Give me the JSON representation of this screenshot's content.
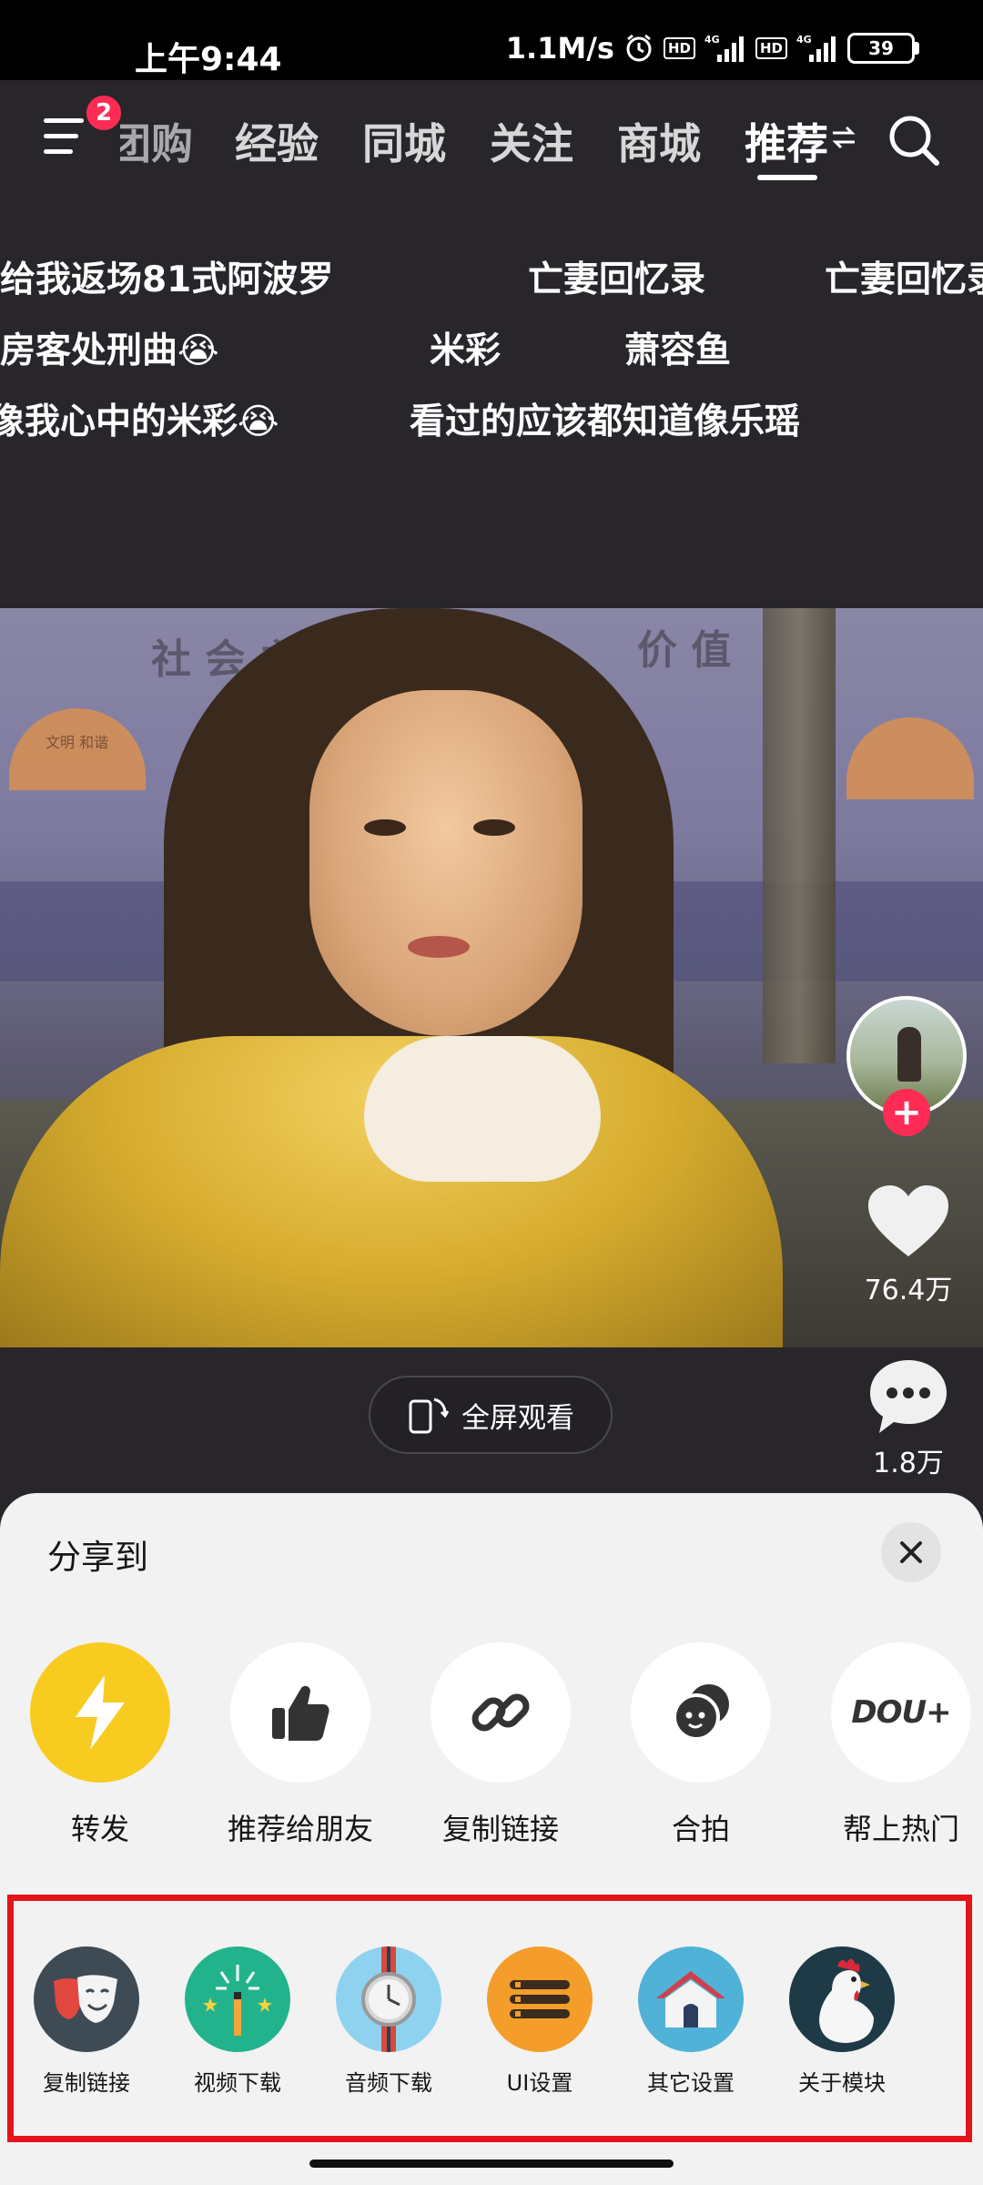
{
  "status_bar": {
    "time": "上午9:44",
    "net_speed": "1.1M/s",
    "hd_label": "HD",
    "net_type": "4G",
    "battery": "39"
  },
  "top_nav": {
    "badge_count": "2",
    "tabs": [
      {
        "label": "团购"
      },
      {
        "label": "经验"
      },
      {
        "label": "同城"
      },
      {
        "label": "关注"
      },
      {
        "label": "商城"
      },
      {
        "label": "推荐"
      }
    ],
    "active_tab": "推荐"
  },
  "danmaku": [
    "给我返场81式阿波罗",
    "亡妻回忆录",
    "亡妻回忆录",
    "房客处刑曲😭",
    "米彩",
    "萧容鱼",
    "像我心中的米彩😭",
    "看过的应该都知道像乐瑶"
  ],
  "video": {
    "wall_text_1": "社 会 主",
    "wall_text_2": "价 值",
    "fan_text": "文明 和谐",
    "like_count": "76.4万",
    "comment_count": "1.8万",
    "fullscreen_label": "全屏观看"
  },
  "share_sheet": {
    "title": "分享到",
    "share_items": [
      {
        "label": "转发",
        "icon": "lightning-icon",
        "color": "#f8cb20"
      },
      {
        "label": "推荐给朋友",
        "icon": "thumbs-up-icon"
      },
      {
        "label": "复制链接",
        "icon": "link-icon"
      },
      {
        "label": "合拍",
        "icon": "duet-icon"
      },
      {
        "label": "帮上热门",
        "icon": "dou-plus-icon",
        "icon_text": "DOU+"
      }
    ],
    "plugin_items": [
      {
        "label": "复制链接",
        "icon": "theater-mask-icon"
      },
      {
        "label": "视频下载",
        "icon": "magic-wand-icon"
      },
      {
        "label": "音频下载",
        "icon": "watch-icon"
      },
      {
        "label": "UI设置",
        "icon": "sliders-icon"
      },
      {
        "label": "其它设置",
        "icon": "house-icon"
      },
      {
        "label": "关于模块",
        "icon": "rooster-icon"
      }
    ]
  },
  "colors": {
    "accent_red": "#fe2c55",
    "highlight_box": "#e5131a",
    "background_dark": "#28262b"
  }
}
